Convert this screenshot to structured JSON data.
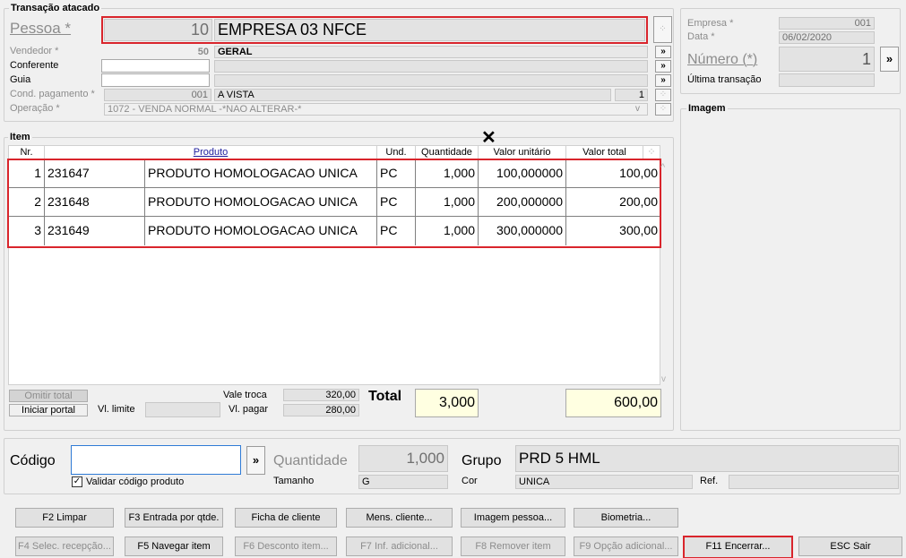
{
  "transaction": {
    "title": "Transação atacado",
    "pessoa_label": "Pessoa *",
    "pessoa_code": "10",
    "pessoa_name": "EMPRESA 03 NFCE",
    "vendedor_label": "Vendedor *",
    "vendedor_code": "50",
    "vendedor_name": "GERAL",
    "conferente_label": "Conferente",
    "guia_label": "Guia",
    "cond_label": "Cond. pagamento *",
    "cond_code": "001",
    "cond_name": "A VISTA",
    "cond_extra": "1",
    "operacao_label": "Operação *",
    "operacao_value": "1072 - VENDA NORMAL -*NAO ALTERAR-*"
  },
  "empresa": {
    "empresa_label": "Empresa *",
    "empresa_value": "001",
    "data_label": "Data *",
    "data_value": "06/02/2020",
    "numero_label": "Número (*)",
    "numero_value": "1",
    "ultima_label": "Última transação"
  },
  "imagem": {
    "title": "Imagem"
  },
  "item": {
    "title": "Item",
    "columns": [
      "Nr.",
      "Produto",
      "Und.",
      "Quantidade",
      "Valor unitário",
      "Valor total"
    ],
    "rows": [
      {
        "nr": "1",
        "code": "231647",
        "produto": "PRODUTO HOMOLOGACAO UNICA",
        "und": "PC",
        "qtd": "1,000",
        "unit": "100,000000",
        "total": "100,00"
      },
      {
        "nr": "2",
        "code": "231648",
        "produto": "PRODUTO HOMOLOGACAO UNICA",
        "und": "PC",
        "qtd": "1,000",
        "unit": "200,000000",
        "total": "200,00"
      },
      {
        "nr": "3",
        "code": "231649",
        "produto": "PRODUTO HOMOLOGACAO UNICA",
        "und": "PC",
        "qtd": "1,000",
        "unit": "300,000000",
        "total": "300,00"
      }
    ]
  },
  "footer": {
    "omitir_total": "Omitir total",
    "iniciar_portal": "Iniciar portal",
    "vl_limite_label": "Vl. limite",
    "vale_troca_label": "Vale troca",
    "vale_troca_value": "320,00",
    "vl_pagar_label": "Vl. pagar",
    "vl_pagar_value": "280,00",
    "total_label": "Total",
    "total_qtd": "3,000",
    "total_value": "600,00"
  },
  "entry": {
    "codigo_label": "Código",
    "codigo_value": "",
    "validar_label": "Validar código produto",
    "quantidade_label": "Quantidade",
    "quantidade_value": "1,000",
    "tamanho_label": "Tamanho",
    "tamanho_value": "G",
    "grupo_label": "Grupo",
    "grupo_value": "PRD 5 HML",
    "cor_label": "Cor",
    "cor_value": "UNICA",
    "ref_label": "Ref."
  },
  "buttons": {
    "row1": [
      "F2 Limpar",
      "F3 Entrada por qtde.",
      "Ficha de cliente",
      "Mens. cliente...",
      "Imagem pessoa...",
      "Biometria..."
    ],
    "row2": [
      "F4 Selec. recepção...",
      "F5 Navegar item",
      "F6 Desconto item...",
      "F7 Inf. adicional...",
      "F8 Remover item",
      "F9 Opção adicional...",
      "F11 Encerrar...",
      "ESC Sair"
    ]
  },
  "icons": {
    "more": "»",
    "dots": "⁘",
    "scroll_up": "^",
    "scroll_down": "v",
    "close": "✕",
    "check": "✓"
  },
  "colors": {
    "highlight": "#d9252c",
    "readonly": "#e3e3e3",
    "total_bg": "#ffffe1"
  }
}
